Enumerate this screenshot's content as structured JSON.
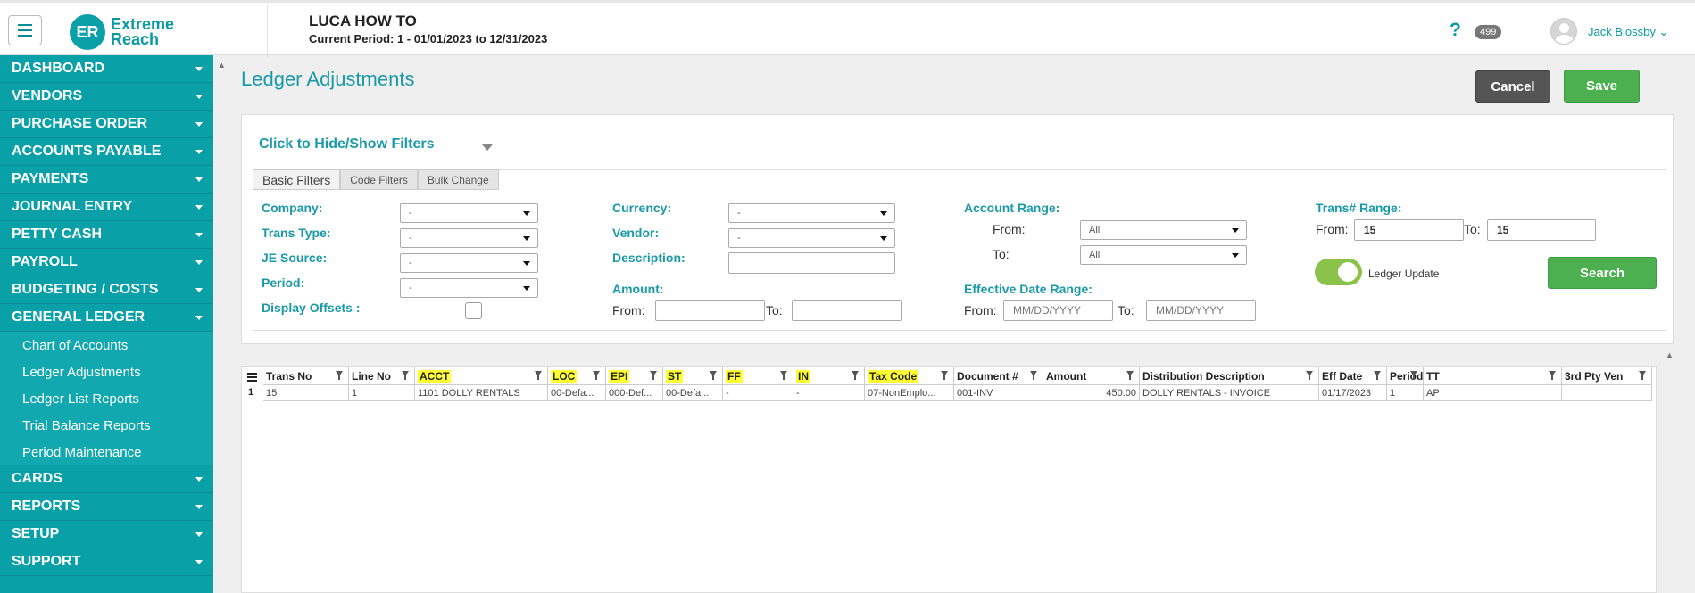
{
  "header": {
    "logo_initials": "ER",
    "logo_line1": "Extreme",
    "logo_line2": "Reach",
    "app_title": "LUCA HOW TO",
    "period_text": "Current Period: 1 - 01/01/2023 to 12/31/2023",
    "help_symbol": "?",
    "notification_count": "499",
    "user_name": "Jack Blossby ⌄"
  },
  "sidebar": {
    "items": [
      {
        "label": "DASHBOARD"
      },
      {
        "label": "VENDORS"
      },
      {
        "label": "PURCHASE ORDER"
      },
      {
        "label": "ACCOUNTS PAYABLE"
      },
      {
        "label": "PAYMENTS"
      },
      {
        "label": "JOURNAL ENTRY"
      },
      {
        "label": "PETTY CASH"
      },
      {
        "label": "PAYROLL"
      },
      {
        "label": "BUDGETING / COSTS"
      },
      {
        "label": "GENERAL LEDGER"
      }
    ],
    "sub_items": [
      {
        "label": "Chart of Accounts"
      },
      {
        "label": "Ledger Adjustments"
      },
      {
        "label": "Ledger List Reports"
      },
      {
        "label": "Trial Balance Reports"
      },
      {
        "label": "Period Maintenance"
      }
    ],
    "items_after": [
      {
        "label": "CARDS"
      },
      {
        "label": "REPORTS"
      },
      {
        "label": "SETUP"
      },
      {
        "label": "SUPPORT"
      }
    ]
  },
  "main": {
    "page_title": "Ledger Adjustments",
    "cancel_label": "Cancel",
    "save_label": "Save",
    "filter_toggle": "Click to Hide/Show Filters",
    "tabs": [
      "Basic Filters",
      "Code Filters",
      "Bulk Change"
    ],
    "filters": {
      "company_label": "Company:",
      "company_value": "-",
      "trans_type_label": "Trans Type:",
      "trans_type_value": "-",
      "je_source_label": "JE Source:",
      "je_source_value": "-",
      "period_label": "Period:",
      "period_value": "-",
      "display_offsets_label": "Display Offsets :",
      "currency_label": "Currency:",
      "currency_value": "-",
      "vendor_label": "Vendor:",
      "vendor_value": "-",
      "description_label": "Description:",
      "description_value": "",
      "amount_label": "Amount:",
      "amount_from_label": "From:",
      "amount_to_label": "To:",
      "account_range_label": "Account Range:",
      "account_from_label": "From:",
      "account_from_value": "All",
      "account_to_label": "To:",
      "account_to_value": "All",
      "eff_date_label": "Effective Date Range:",
      "eff_from_label": "From:",
      "eff_from_placeholder": "MM/DD/YYYY",
      "eff_to_label": "To:",
      "eff_to_placeholder": "MM/DD/YYYY",
      "trans_range_label": "Trans# Range:",
      "trans_from_label": "From:",
      "trans_from_value": "15",
      "trans_to_label": "To:",
      "trans_to_value": "15",
      "ledger_update_label": "Ledger Update",
      "search_label": "Search"
    }
  },
  "grid": {
    "columns": [
      {
        "label": "Trans No",
        "highlight": false
      },
      {
        "label": "Line No",
        "highlight": false
      },
      {
        "label": "ACCT",
        "highlight": true
      },
      {
        "label": "LOC",
        "highlight": true
      },
      {
        "label": "EPI",
        "highlight": true
      },
      {
        "label": "ST",
        "highlight": true
      },
      {
        "label": "FF",
        "highlight": true
      },
      {
        "label": "IN",
        "highlight": true
      },
      {
        "label": "Tax Code",
        "highlight": true
      },
      {
        "label": "Document #",
        "highlight": false
      },
      {
        "label": "Amount",
        "highlight": false
      },
      {
        "label": "Distribution Description",
        "highlight": false
      },
      {
        "label": "Eff Date",
        "highlight": false
      },
      {
        "label": "Period",
        "highlight": false
      },
      {
        "label": "TT",
        "highlight": false
      },
      {
        "label": "3rd Pty Ven",
        "highlight": false
      }
    ],
    "rows": [
      {
        "num": "1",
        "cells": [
          "15",
          "1",
          "1101 DOLLY RENTALS",
          "00-Defa...",
          "000-Def...",
          "00-Defa...",
          "-",
          "-",
          "07-NonEmplo...",
          "001-INV",
          "450.00",
          "DOLLY RENTALS - INVOICE",
          "01/17/2023",
          "1",
          "AP",
          ""
        ]
      }
    ]
  },
  "colors": {
    "teal": "#0aa0a8",
    "green": "#4caf50",
    "highlight": "#ffff33"
  }
}
